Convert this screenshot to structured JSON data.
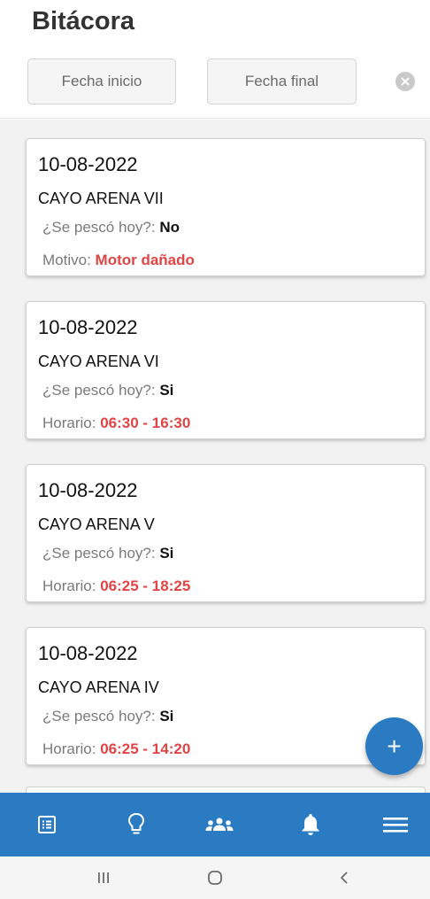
{
  "header": {
    "title": "Bitácora",
    "date_start_placeholder": "Fecha inicio",
    "date_end_placeholder": "Fecha final",
    "clear_icon": "clear-icon"
  },
  "entries": [
    {
      "date": "10-08-2022",
      "vessel": "CAYO ARENA VII",
      "fished_label": "¿Se pescó hoy?:",
      "fished_value": "No",
      "detail_label": "Motivo:",
      "detail_value": "Motor dañado"
    },
    {
      "date": "10-08-2022",
      "vessel": "CAYO ARENA VI",
      "fished_label": "¿Se pescó hoy?:",
      "fished_value": "Si",
      "detail_label": "Horario:",
      "detail_value": "06:30 - 16:30"
    },
    {
      "date": "10-08-2022",
      "vessel": "CAYO ARENA V",
      "fished_label": "¿Se pescó hoy?:",
      "fished_value": "Si",
      "detail_label": "Horario:",
      "detail_value": "06:25 - 18:25"
    },
    {
      "date": "10-08-2022",
      "vessel": "CAYO ARENA IV",
      "fished_label": "¿Se pescó hoy?:",
      "fished_value": "Si",
      "detail_label": "Horario:",
      "detail_value": "06:25 - 14:20"
    }
  ],
  "fab": {
    "label": "+",
    "icon": "plus-icon"
  },
  "bottom_nav": {
    "items": [
      {
        "icon": "logbook-icon"
      },
      {
        "icon": "lightbulb-icon"
      },
      {
        "icon": "group-icon"
      },
      {
        "icon": "bell-icon"
      },
      {
        "icon": "menu-icon"
      }
    ]
  },
  "system_nav": {
    "recents_icon": "recents-icon",
    "home_icon": "home-icon",
    "back_icon": "back-icon"
  },
  "colors": {
    "accent": "#2a7bc1",
    "highlight_red": "#e04545",
    "list_background": "#f2f2f2"
  }
}
